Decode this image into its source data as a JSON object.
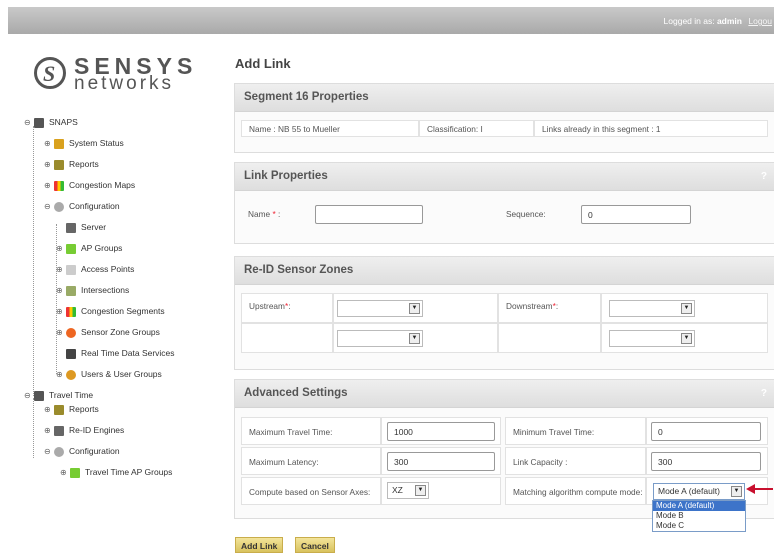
{
  "header": {
    "logged_in_label": "Logged in as:",
    "user": "admin",
    "logout": "Logou"
  },
  "logo": {
    "line1": "SENSYS",
    "line2": "networks"
  },
  "tree": {
    "snaps": "SNAPS",
    "system_status": "System Status",
    "reports": "Reports",
    "congestion_maps": "Congestion Maps",
    "configuration": "Configuration",
    "server": "Server",
    "ap_groups": "AP Groups",
    "access_points": "Access Points",
    "intersections": "Intersections",
    "congestion_segments": "Congestion Segments",
    "sensor_zone_groups": "Sensor Zone Groups",
    "real_time_data_services": "Real Time Data Services",
    "users_groups": "Users & User Groups",
    "travel_time": "Travel Time",
    "tt_reports": "Reports",
    "reid_engines": "Re-ID Engines",
    "tt_configuration": "Configuration",
    "tt_ap_groups": "Travel Time AP Groups"
  },
  "page": {
    "title": "Add Link"
  },
  "segment": {
    "title": "Segment 16 Properties",
    "name": "Name : NB 55 to Mueller",
    "classification": "Classification: I",
    "links": "Links already in this segment : 1"
  },
  "link": {
    "title": "Link Properties",
    "help": "?",
    "name_label": "Name",
    "name_value": "",
    "sequence_label": "Sequence:",
    "sequence_value": "0"
  },
  "reid": {
    "title": "Re-ID Sensor Zones",
    "upstream_label": "Upstream",
    "downstream_label": "Downstream"
  },
  "advanced": {
    "title": "Advanced Settings",
    "help": "?",
    "max_tt_label": "Maximum Travel Time:",
    "max_tt_value": "1000",
    "min_tt_label": "Minimum Travel Time:",
    "min_tt_value": "0",
    "max_lat_label": "Maximum Latency:",
    "max_lat_value": "300",
    "link_cap_label": "Link Capacity :",
    "link_cap_value": "300",
    "axes_label": "Compute based on Sensor Axes:",
    "axes_value": "XZ",
    "mode_label": "Matching algorithm compute mode:",
    "mode_value": "Mode A (default)",
    "mode_options": [
      "Mode A (default)",
      "Mode B",
      "Mode C"
    ]
  },
  "buttons": {
    "add": "Add Link",
    "cancel": "Cancel"
  },
  "colors": {
    "arrow": "#c8102e",
    "button": "#e8d27a",
    "dropdown_highlight": "#3d74c9"
  }
}
